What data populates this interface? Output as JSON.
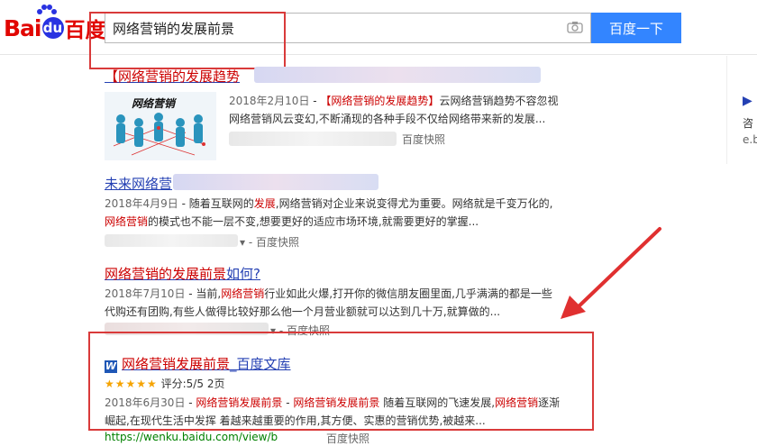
{
  "header": {
    "logo_bai": "Bai",
    "logo_du": "du",
    "logo_cn": "百度",
    "search_value": "网络营销的发展前景",
    "search_button": "百度一下",
    "camera_icon": "camera-icon"
  },
  "results": [
    {
      "title_prefix": "【网络营销的发展趋势",
      "date": "2018年2月10日",
      "snippet_a_hl": "【网络营销的发展趋势】",
      "snippet_a_rest": "云网络营销趋势不容忽视",
      "snippet_b": "网络营销风云变幻,不断涌现的各种手段不仅给网络带来新的发展...",
      "snapshot": "百度快照",
      "thumb_text": "网络营销"
    },
    {
      "title_prefix": "未来网络营",
      "date": "2018年4月9日",
      "snippet_a_pre": " - 随着互联网的",
      "snippet_a_hl": "发展",
      "snippet_a_rest": ",网络营销对企业来说变得尤为重要。网络就是千变万化的,",
      "snippet_b_hl": "网络营销",
      "snippet_b_rest": "的模式也不能一层不变,想要更好的适应市场环境,就需要更好的掌握...",
      "snapshot": "百度快照"
    },
    {
      "title_hl": "网络营销的发展前景",
      "title_rest": "如何?",
      "date": "2018年7月10日",
      "snippet_a_pre": " - 当前,",
      "snippet_a_hl": "网络营销",
      "snippet_a_rest": "行业如此火爆,打开你的微信朋友圈里面,几乎满满的都是一些",
      "snippet_b": "代购还有团购,有些人做得比较好那么他一个月营业额就可以达到几十万,就算做的...",
      "snapshot": "百度快照"
    },
    {
      "title_hl": "网络营销发展前景",
      "title_rest": "_百度文库",
      "word_icon": "W",
      "stars": "★★★★★",
      "rating": "评分:5/5",
      "pages": "2页",
      "date": "2018年6月30日",
      "snippet_a_hl1": "网络营销发展前景",
      "snippet_a_hl2": "网络营销发展前景",
      "snippet_a_mid": "随着互联网的飞速发展,",
      "snippet_a_hl3": "网络营销",
      "snippet_a_end": "逐渐",
      "snippet_b": "崛起,在现代生活中发挥 着越来越重要的作用,其方便、实惠的营销优势,被越来...",
      "url": "https://wenku.baidu.com/view/b",
      "snapshot": "百度快照"
    }
  ],
  "sidebar": {
    "arrow_glyph": "▶",
    "line1": "咨",
    "line2": "e.b"
  }
}
